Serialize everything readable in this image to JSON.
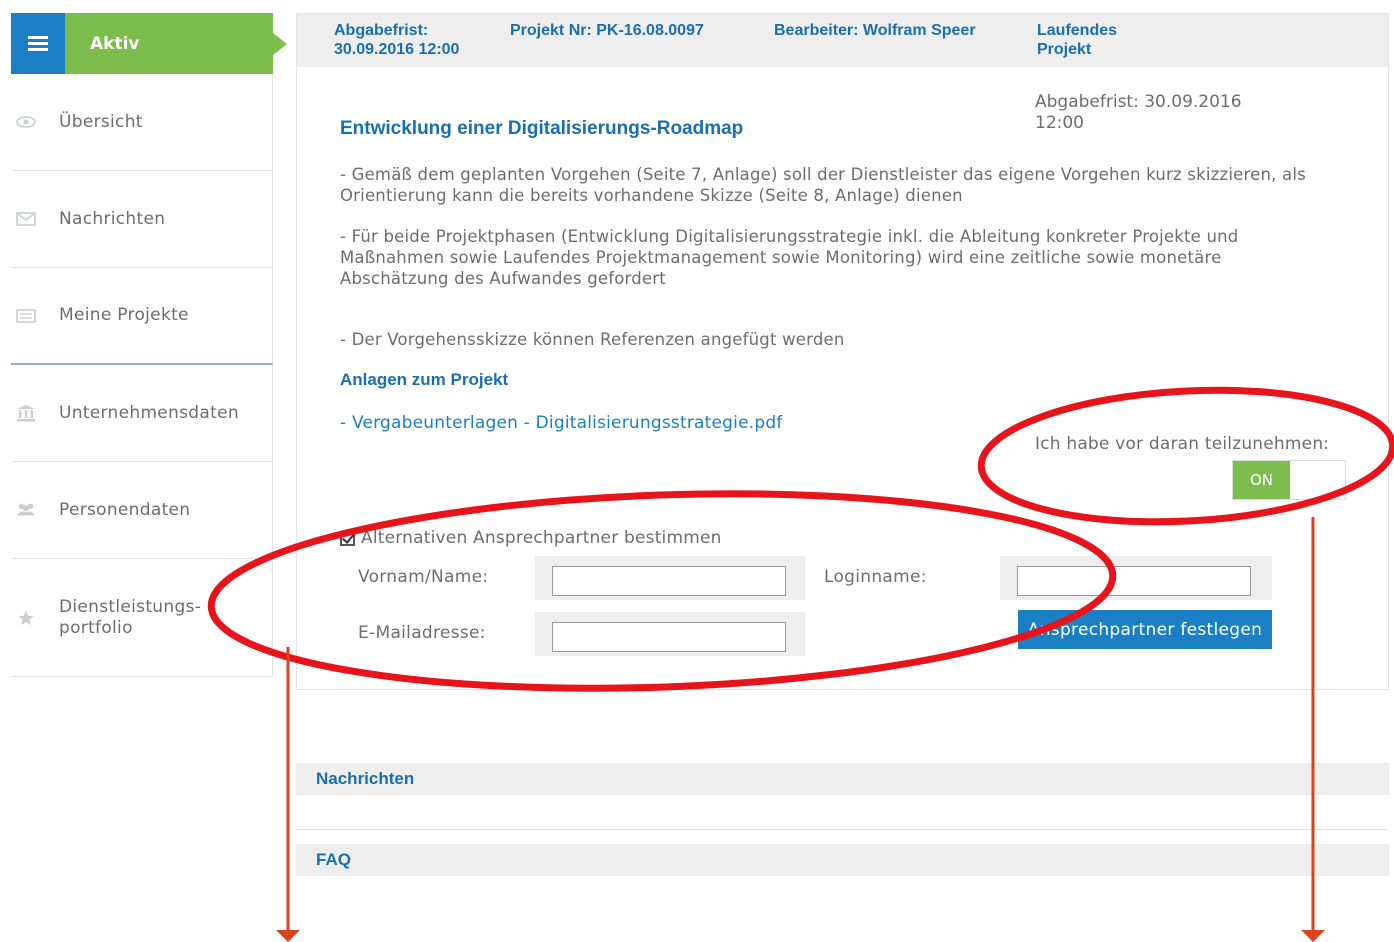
{
  "sidebar": {
    "active_label": "Aktiv",
    "items": [
      {
        "name": "uebersicht",
        "icon": "eye-icon",
        "label_lines": [
          "Übersicht"
        ]
      },
      {
        "name": "nachrichten",
        "icon": "envelope-icon",
        "label_lines": [
          "Nachrichten"
        ]
      },
      {
        "name": "meine-projekte",
        "icon": "list-icon",
        "label_lines": [
          "Meine Projekte"
        ]
      },
      {
        "name": "unternehmensdaten",
        "icon": "bank-icon",
        "label_lines": [
          "Unternehmensdaten"
        ]
      },
      {
        "name": "personendaten",
        "icon": "users-icon",
        "label_lines": [
          "Personendaten"
        ]
      },
      {
        "name": "dienstleistungsportfolio",
        "icon": "star-icon",
        "label_lines": [
          "Dienstleistungs-",
          "portfolio"
        ]
      }
    ]
  },
  "header": {
    "deadline_line1": "Abgabefrist:",
    "deadline_line2": "30.09.2016 12:00",
    "project_nr": "Projekt Nr: PK-16.08.0097",
    "editor": "Bearbeiter: Wolfram Speer",
    "status_line1": "Laufendes",
    "status_line2": "Projekt"
  },
  "project": {
    "title": "Entwicklung einer Digitalisierungs-Roadmap",
    "deadline_line1": "Abgabefrist: 30.09.2016",
    "deadline_line2": "12:00",
    "para1_line1": "- Gemäß dem geplanten Vorgehen (Seite 7, Anlage) soll der Dienstleister das eigene Vorgehen kurz skizzieren, als",
    "para1_line2": "Orientierung kann die bereits vorhandene Skizze (Seite 8, Anlage) dienen",
    "para2_line1": "- Für beide Projektphasen (Entwicklung Digitalisierungsstrategie inkl. die Ableitung konkreter Projekte und",
    "para2_line2": "Maßnahmen sowie Laufendes Projektmanagement sowie Monitoring) wird eine zeitliche sowie monetäre",
    "para2_line3": "Abschätzung des Aufwandes gefordert",
    "para3": "- Der Vorgehensskizze können Referenzen angefügt werden",
    "attachments_heading": "Anlagen zum Projekt",
    "attachment_link": "- Vergabeunterlagen - Digitalisierungsstrategie.pdf",
    "participate_label": "Ich habe vor daran teilzunehmen:",
    "toggle_state": "ON"
  },
  "contact_form": {
    "checkbox_label": "Alternativen Ansprechpartner bestimmen",
    "name_label": "Vornam/Name:",
    "login_label": "Loginname:",
    "email_label": "E-Mailadresse:",
    "name_value": "",
    "login_value": "",
    "email_value": "",
    "submit_label": "Ansprechpartner festlegen"
  },
  "sections": {
    "messages": "Nachrichten",
    "faq": "FAQ"
  },
  "colors": {
    "accent_blue": "#1a7fc4",
    "accent_green": "#7dbd4e",
    "annotation_red": "#e8141c"
  }
}
